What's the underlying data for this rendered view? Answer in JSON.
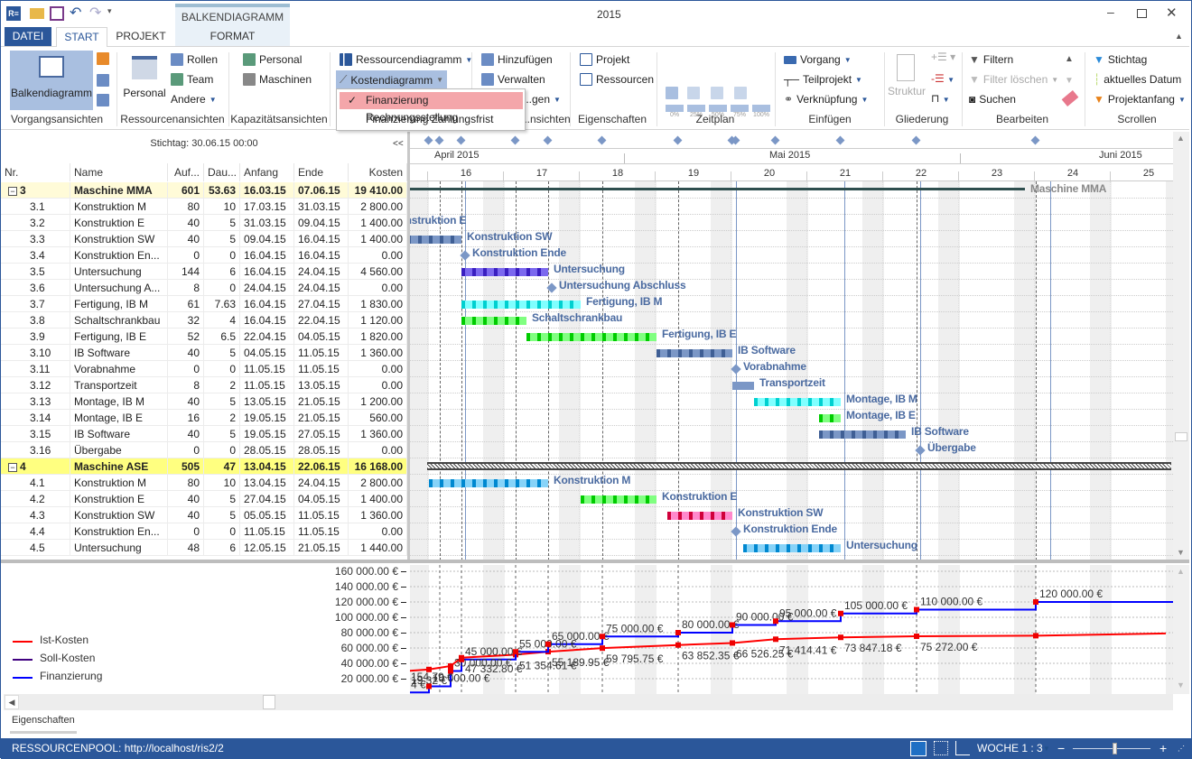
{
  "window": {
    "title": "2015",
    "app_icon": "ris-app-icon",
    "contextual_tab_group": "BALKENDIAGRAMM"
  },
  "quick_access": [
    "open-folder-icon",
    "save-icon",
    "undo-icon",
    "redo-icon",
    "customize-dropdown-icon"
  ],
  "tabs": [
    {
      "label": "DATEI"
    },
    {
      "label": "START"
    },
    {
      "label": "PROJEKT"
    },
    {
      "label": "FORMAT"
    }
  ],
  "active_tab": "START",
  "ribbon": {
    "vorgangsansichten": {
      "label": "Vorgangsansichten",
      "main": "Balkendiagramm"
    },
    "ressourcenansichten": {
      "label": "Ressourcenansichten",
      "main": "Personal",
      "items": [
        "Rollen",
        "Team",
        "Andere"
      ]
    },
    "kapazitaet": {
      "label": "Kapazitätsansichten",
      "items": [
        "Personal",
        "Maschinen"
      ]
    },
    "diagramme": {
      "items": [
        "Ressourcendiagramm",
        "Kostendiagramm"
      ]
    },
    "verwalten": {
      "label": "...nsichten",
      "items": [
        "Hinzufügen",
        "Verwalten",
        "...gen"
      ]
    },
    "eigenschaften": {
      "label": "Eigenschaften",
      "items": [
        "Projekt",
        "Ressourcen"
      ]
    },
    "zeitplan": {
      "label": "Zeitplan",
      "progress": [
        "0%",
        "25%",
        "50%",
        "75%",
        "100%"
      ]
    },
    "einfuegen": {
      "label": "Einfügen",
      "items": [
        "Vorgang",
        "Teilprojekt",
        "Verknüpfung"
      ]
    },
    "gliederung": {
      "label": "Gliederung",
      "main": "Struktur"
    },
    "bearbeiten": {
      "label": "Bearbeiten",
      "items": [
        "Filtern",
        "Filter löschen",
        "Suchen"
      ]
    },
    "scrollen": {
      "label": "Scrollen",
      "items": [
        "Stichtag",
        "aktuelles Datum",
        "Projektanfang"
      ]
    }
  },
  "kosten_menu": {
    "items": [
      {
        "label": "Finanzierung Rechnungsstellung",
        "checked": true
      },
      {
        "label": "Finanzierung Zahlungsfrist",
        "checked": false
      }
    ]
  },
  "table": {
    "stichtag": "Stichtag: 30.06.15 00:00",
    "collapse_label": "<<",
    "columns": [
      "Nr.",
      "Name",
      "Auf...",
      "Dau...",
      "Anfang",
      "Ende",
      "Kosten"
    ],
    "rows": [
      {
        "nr": "3",
        "name": "Maschine MMA",
        "auf": "601",
        "dau": "53.63",
        "anfang": "16.03.15",
        "ende": "07.06.15",
        "kosten": "19 410.00",
        "summary": true,
        "bar": "summary-line"
      },
      {
        "nr": "3.1",
        "name": "Konstruktion M",
        "auf": "80",
        "dau": "10",
        "anfang": "17.03.15",
        "ende": "31.03.15",
        "kosten": "2 800.00",
        "bar": "steel"
      },
      {
        "nr": "3.2",
        "name": "Konstruktion E",
        "auf": "40",
        "dau": "5",
        "anfang": "31.03.15",
        "ende": "09.04.15",
        "kosten": "1 400.00",
        "bar": "steel"
      },
      {
        "nr": "3.3",
        "name": "Konstruktion SW",
        "auf": "40",
        "dau": "5",
        "anfang": "09.04.15",
        "ende": "16.04.15",
        "kosten": "1 400.00",
        "bar": "steel"
      },
      {
        "nr": "3.4",
        "name": "Konstruktion En...",
        "gantt_label": "Konstruktion Ende",
        "auf": "0",
        "dau": "0",
        "anfang": "16.04.15",
        "ende": "16.04.15",
        "kosten": "0.00",
        "bar": "milestone"
      },
      {
        "nr": "3.5",
        "name": "Untersuchung",
        "auf": "144",
        "dau": "6",
        "anfang": "16.04.15",
        "ende": "24.04.15",
        "kosten": "4 560.00",
        "bar": "purple"
      },
      {
        "nr": "3.6",
        "name": "Untersuchung A...",
        "gantt_label": "Untersuchung Abschluss",
        "auf": "8",
        "dau": "0",
        "anfang": "24.04.15",
        "ende": "24.04.15",
        "kosten": "0.00",
        "bar": "milestone"
      },
      {
        "nr": "3.7",
        "name": "Fertigung, IB M",
        "auf": "61",
        "dau": "7.63",
        "anfang": "16.04.15",
        "ende": "27.04.15",
        "kosten": "1 830.00",
        "bar": "cyan"
      },
      {
        "nr": "3.8",
        "name": "Schaltschrankbau",
        "auf": "32",
        "dau": "4",
        "anfang": "16.04.15",
        "ende": "22.04.15",
        "kosten": "1 120.00",
        "bar": "green"
      },
      {
        "nr": "3.9",
        "name": "Fertigung, IB E",
        "auf": "52",
        "dau": "6.5",
        "anfang": "22.04.15",
        "ende": "04.05.15",
        "kosten": "1 820.00",
        "bar": "green"
      },
      {
        "nr": "3.10",
        "name": "IB Software",
        "auf": "40",
        "dau": "5",
        "anfang": "04.05.15",
        "ende": "11.05.15",
        "kosten": "1 360.00",
        "bar": "steel"
      },
      {
        "nr": "3.11",
        "name": "Vorabnahme",
        "auf": "0",
        "dau": "0",
        "anfang": "11.05.15",
        "ende": "11.05.15",
        "kosten": "0.00",
        "bar": "milestone"
      },
      {
        "nr": "3.12",
        "name": "Transportzeit",
        "auf": "8",
        "dau": "2",
        "anfang": "11.05.15",
        "ende": "13.05.15",
        "kosten": "0.00",
        "bar": "steel-plain"
      },
      {
        "nr": "3.13",
        "name": "Montage, IB M",
        "auf": "40",
        "dau": "5",
        "anfang": "13.05.15",
        "ende": "21.05.15",
        "kosten": "1 200.00",
        "bar": "cyan"
      },
      {
        "nr": "3.14",
        "name": "Montage, IB E",
        "auf": "16",
        "dau": "2",
        "anfang": "19.05.15",
        "ende": "21.05.15",
        "kosten": "560.00",
        "bar": "green"
      },
      {
        "nr": "3.15",
        "name": "IB Software",
        "auf": "40",
        "dau": "5",
        "anfang": "19.05.15",
        "ende": "27.05.15",
        "kosten": "1 360.00",
        "bar": "steel"
      },
      {
        "nr": "3.16",
        "name": "Übergabe",
        "auf": "0",
        "dau": "0",
        "anfang": "28.05.15",
        "ende": "28.05.15",
        "kosten": "0.00",
        "bar": "milestone"
      },
      {
        "nr": "4",
        "name": "Maschine ASE",
        "auf": "505",
        "dau": "47",
        "anfang": "13.04.15",
        "ende": "22.06.15",
        "kosten": "16 168.00",
        "summary": true,
        "highlight": true,
        "bar": "summary-hatch"
      },
      {
        "nr": "4.1",
        "name": "Konstruktion M",
        "auf": "80",
        "dau": "10",
        "anfang": "13.04.15",
        "ende": "24.04.15",
        "kosten": "2 800.00",
        "bar": "lightblue"
      },
      {
        "nr": "4.2",
        "name": "Konstruktion E",
        "auf": "40",
        "dau": "5",
        "anfang": "27.04.15",
        "ende": "04.05.15",
        "kosten": "1 400.00",
        "bar": "green"
      },
      {
        "nr": "4.3",
        "name": "Konstruktion SW",
        "auf": "40",
        "dau": "5",
        "anfang": "05.05.15",
        "ende": "11.05.15",
        "kosten": "1 360.00",
        "bar": "pink"
      },
      {
        "nr": "4.4",
        "name": "Konstruktion En...",
        "gantt_label": "Konstruktion Ende",
        "auf": "0",
        "dau": "0",
        "anfang": "11.05.15",
        "ende": "11.05.15",
        "kosten": "0.00",
        "bar": "milestone"
      },
      {
        "nr": "4.5",
        "name": "Untersuchung",
        "auf": "48",
        "dau": "6",
        "anfang": "12.05.15",
        "ende": "21.05.15",
        "kosten": "1 440.00",
        "bar": "lightblue"
      }
    ]
  },
  "timeline": {
    "months": [
      "April 2015",
      "Mai 2015",
      "Juni 2015"
    ],
    "weeks": [
      "16",
      "17",
      "18",
      "19",
      "20",
      "21",
      "22",
      "23",
      "24",
      "25"
    ]
  },
  "bar_colors": {
    "steel": [
      "#7b97c6",
      "#3f5f95"
    ],
    "steel-plain": [
      "#7b97c6",
      "#7b97c6"
    ],
    "purple": [
      "#7b68ee",
      "#3a1fc0"
    ],
    "cyan": [
      "#80ffff",
      "#00d0d0"
    ],
    "green": [
      "#80ff80",
      "#00cc00"
    ],
    "lightblue": [
      "#87d3f8",
      "#0088d0"
    ],
    "pink": [
      "#ff88cc",
      "#d0003a"
    ],
    "summary-line": [
      "#2f4f4f",
      "#2f4f4f"
    ]
  },
  "chart_data": {
    "type": "line",
    "ylim": [
      0,
      160000
    ],
    "yticks": [
      "160 000.00 €",
      "140 000.00 €",
      "120 000.00 €",
      "100 000.00 €",
      "80 000.00 €",
      "60 000.00 €",
      "40 000.00 €",
      "20 000.00 €"
    ],
    "ytick_values": [
      160000,
      140000,
      120000,
      100000,
      80000,
      60000,
      40000,
      20000
    ],
    "legend": "left",
    "grid": true,
    "series": [
      {
        "name": "Ist-Kosten",
        "color": "#ff0000",
        "style": "line",
        "points": [
          {
            "x": "11.04.15",
            "y": 30000
          },
          {
            "x": "13.04.15",
            "y": 32000,
            "label": "19.32 €"
          },
          {
            "x": "15.04.15",
            "y": 36500,
            "label": "154.79 €"
          },
          {
            "x": "16.04.15",
            "y": 47332.8,
            "label": "47 332.80 €"
          },
          {
            "x": "21.04.15",
            "y": 51354.61,
            "label": "51 354.61 €"
          },
          {
            "x": "24.04.15",
            "y": 55189.95,
            "label": "55 189.95 €"
          },
          {
            "x": "29.04.15",
            "y": 59795.75,
            "label": "59 795.75 €"
          },
          {
            "x": "06.05.15",
            "y": 63852.35,
            "label": "63 852.35 €"
          },
          {
            "x": "11.05.15",
            "y": 66526.25,
            "label": "66 526.25 €"
          },
          {
            "x": "15.05.15",
            "y": 71414.41,
            "label": "71 414.41 €"
          },
          {
            "x": "21.05.15",
            "y": 73847.18,
            "label": "73 847.18 €"
          },
          {
            "x": "28.05.15",
            "y": 75272.0,
            "label": "75 272.00 €"
          },
          {
            "x": "08.06.15",
            "y": 76000
          },
          {
            "x": "20.06.15",
            "y": 79000
          }
        ]
      },
      {
        "name": "Soll-Kosten",
        "color": "#400080",
        "style": "line",
        "points": []
      },
      {
        "name": "Finanzierung",
        "color": "#0000ff",
        "style": "step",
        "points": [
          {
            "x": "11.04.15",
            "y": 2000,
            "label": "4 €"
          },
          {
            "x": "13.04.15",
            "y": 10000,
            "label": "10 000.00 €"
          },
          {
            "x": "15.04.15",
            "y": 30000,
            "label": "30 000.00 €"
          },
          {
            "x": "16.04.15",
            "y": 45000,
            "label": "45 000.00 €"
          },
          {
            "x": "21.04.15",
            "y": 55000,
            "label": "55 000.00 €"
          },
          {
            "x": "24.04.15",
            "y": 65000,
            "label": "65 000.00 €"
          },
          {
            "x": "29.04.15",
            "y": 75000,
            "label": "75 000.00 €"
          },
          {
            "x": "06.05.15",
            "y": 80000,
            "label": "80 000.00 €"
          },
          {
            "x": "11.05.15",
            "y": 90000,
            "label": "90 000.00 €"
          },
          {
            "x": "15.05.15",
            "y": 95000,
            "label": "95 000.00 €"
          },
          {
            "x": "21.05.15",
            "y": 105000,
            "label": "105 000.00 €"
          },
          {
            "x": "28.05.15",
            "y": 110000,
            "label": "110 000.00 €"
          },
          {
            "x": "08.06.15",
            "y": 120000,
            "label": "120 000.00 €"
          },
          {
            "x": "20.06.15",
            "y": 120000
          }
        ]
      }
    ]
  },
  "bottom_tab": "Eigenschaften",
  "status": {
    "left": "RESSOURCENPOOL: http://localhost/ris2/2",
    "zoom_label": "WOCHE 1 : 3",
    "zoom_level": 0.55
  }
}
